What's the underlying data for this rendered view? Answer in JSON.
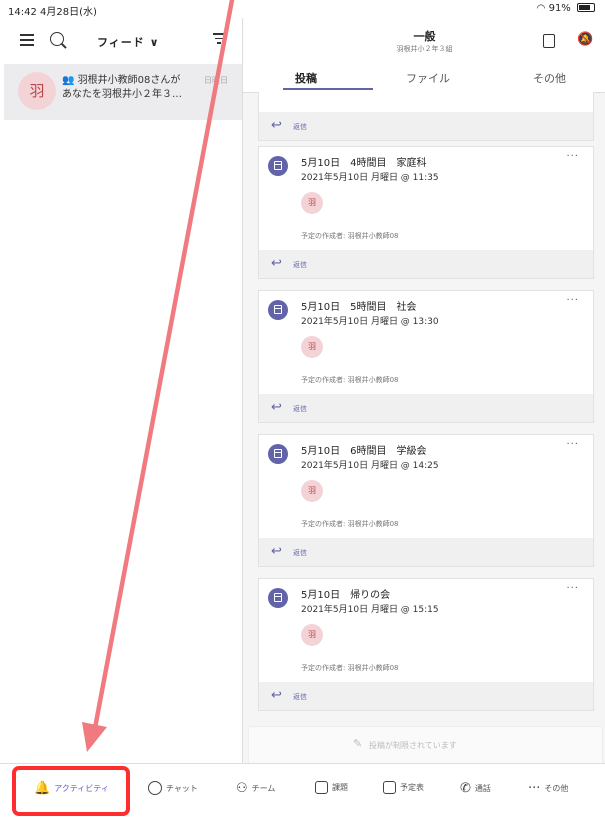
{
  "status": {
    "time": "14:42  4月28日(水)",
    "battery": "91%"
  },
  "feed": {
    "title": "フィード ∨",
    "item": {
      "avatar": "羽",
      "line1": "羽根井小教師08さんが",
      "line2": "あなたを羽根井小２年３…",
      "date": "日曜日"
    }
  },
  "channel": {
    "title": "一般",
    "subtitle": "羽根井小２年３組",
    "tabs": [
      "投稿",
      "ファイル",
      "その他"
    ]
  },
  "posts": [
    {
      "title": "5月10日　4時間目　家庭科",
      "datetime": "2021年5月10日 月曜日 @ 11:35",
      "avatar": "羽",
      "creator": "予定の作成者: 羽根井小教師08",
      "reply": "返信"
    },
    {
      "title": "5月10日　5時間目　社会",
      "datetime": "2021年5月10日 月曜日 @ 13:30",
      "avatar": "羽",
      "creator": "予定の作成者: 羽根井小教師08",
      "reply": "返信"
    },
    {
      "title": "5月10日　6時間目　学級会",
      "datetime": "2021年5月10日 月曜日 @ 14:25",
      "avatar": "羽",
      "creator": "予定の作成者: 羽根井小教師08",
      "reply": "返信"
    },
    {
      "title": "5月10日　帰りの会",
      "datetime": "2021年5月10日 月曜日 @ 15:15",
      "avatar": "羽",
      "creator": "予定の作成者: 羽根井小教師08",
      "reply": "返信"
    }
  ],
  "first_reply": "返信",
  "compose_text": "投稿が制限されています",
  "nav": {
    "activity": "アクティビティ",
    "chat": "チャット",
    "teams": "チーム",
    "assignments": "課題",
    "calendar": "予定表",
    "calls": "通話",
    "more": "その他"
  },
  "colors": {
    "accent": "#6264a7",
    "highlight": "#ff2d2d",
    "arrow": "#f07a80"
  }
}
